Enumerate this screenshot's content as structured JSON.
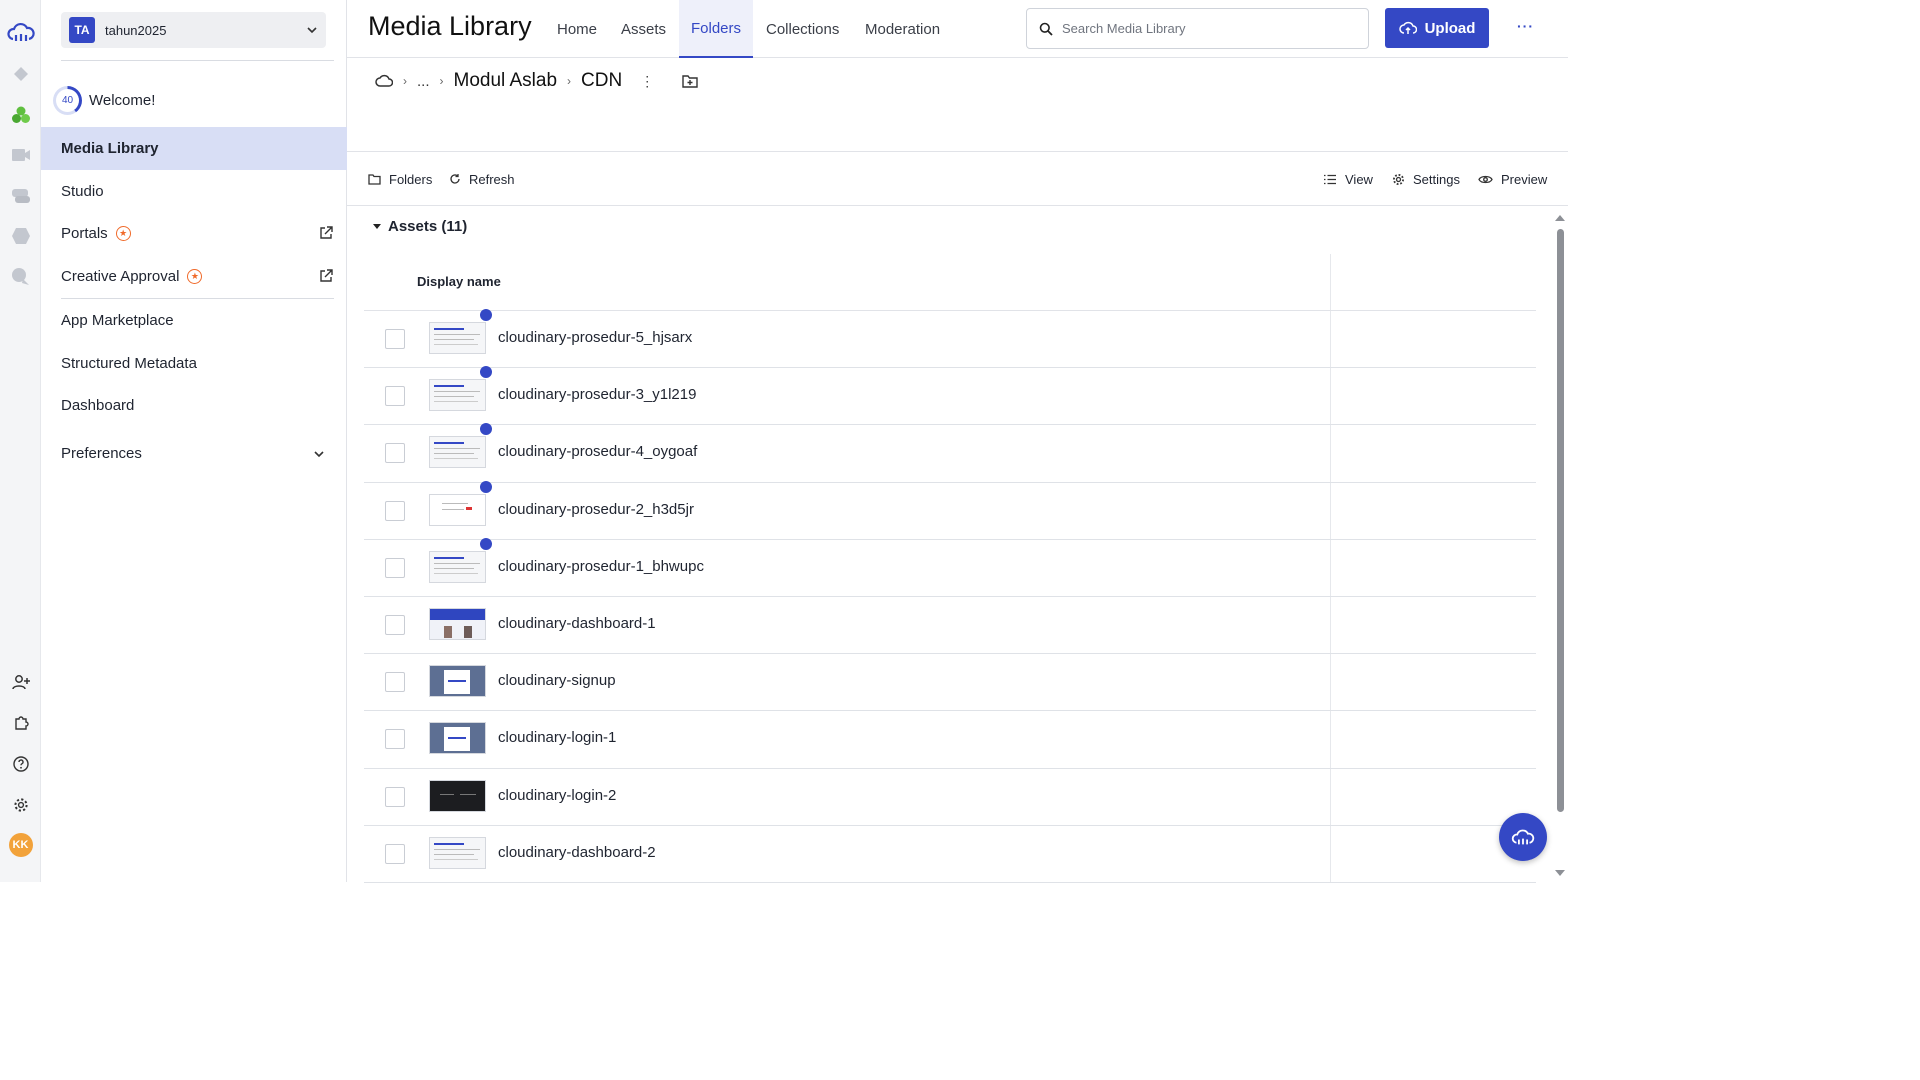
{
  "rail": {
    "icons": [
      "cloudinary-logo-icon",
      "programmable-media-icon",
      "assets-icon",
      "video-icon",
      "chat-icon",
      "tag-icon",
      "support-icon"
    ],
    "bottom_icons": [
      "add-user-icon",
      "puzzle-icon",
      "help-icon",
      "settings-icon"
    ],
    "avatar": "KK",
    "colors": {
      "brand": "#3448c5",
      "green": "#5fbf3f",
      "gray": "#b8bcc4"
    }
  },
  "sidebar": {
    "account_badge": "TA",
    "account_name": "tahun2025",
    "welcome_progress": "40",
    "welcome_label": "Welcome!",
    "items": [
      {
        "label": "Media Library"
      },
      {
        "label": "Studio"
      },
      {
        "label": "Portals"
      },
      {
        "label": "Creative Approval"
      },
      {
        "label": "App Marketplace"
      },
      {
        "label": "Structured Metadata"
      },
      {
        "label": "Dashboard"
      },
      {
        "label": "Preferences"
      }
    ]
  },
  "header": {
    "title": "Media Library",
    "tabs": [
      "Home",
      "Assets",
      "Folders",
      "Collections",
      "Moderation"
    ],
    "active_tab": "Folders",
    "search_placeholder": "Search Media Library",
    "upload_label": "Upload",
    "more_label": "···"
  },
  "breadcrumb": {
    "ellipsis": "...",
    "items": [
      "Modul Aslab",
      "CDN"
    ]
  },
  "toolbar": {
    "folders": "Folders",
    "refresh": "Refresh",
    "view": "View",
    "settings": "Settings",
    "preview": "Preview"
  },
  "assets": {
    "header": "Assets (11)",
    "column": "Display name",
    "rows": [
      {
        "name": "cloudinary-prosedur-5_hjsarx",
        "new": true,
        "thumb": "light"
      },
      {
        "name": "cloudinary-prosedur-3_y1l219",
        "new": true,
        "thumb": "light"
      },
      {
        "name": "cloudinary-prosedur-4_oygoaf",
        "new": true,
        "thumb": "light"
      },
      {
        "name": "cloudinary-prosedur-2_h3d5jr",
        "new": true,
        "thumb": "white"
      },
      {
        "name": "cloudinary-prosedur-1_bhwupc",
        "new": true,
        "thumb": "light"
      },
      {
        "name": "cloudinary-dashboard-1",
        "new": false,
        "thumb": "blue"
      },
      {
        "name": "cloudinary-signup",
        "new": false,
        "thumb": "slate"
      },
      {
        "name": "cloudinary-login-1",
        "new": false,
        "thumb": "slate"
      },
      {
        "name": "cloudinary-login-2",
        "new": false,
        "thumb": "dark"
      },
      {
        "name": "cloudinary-dashboard-2",
        "new": false,
        "thumb": "light"
      }
    ]
  }
}
